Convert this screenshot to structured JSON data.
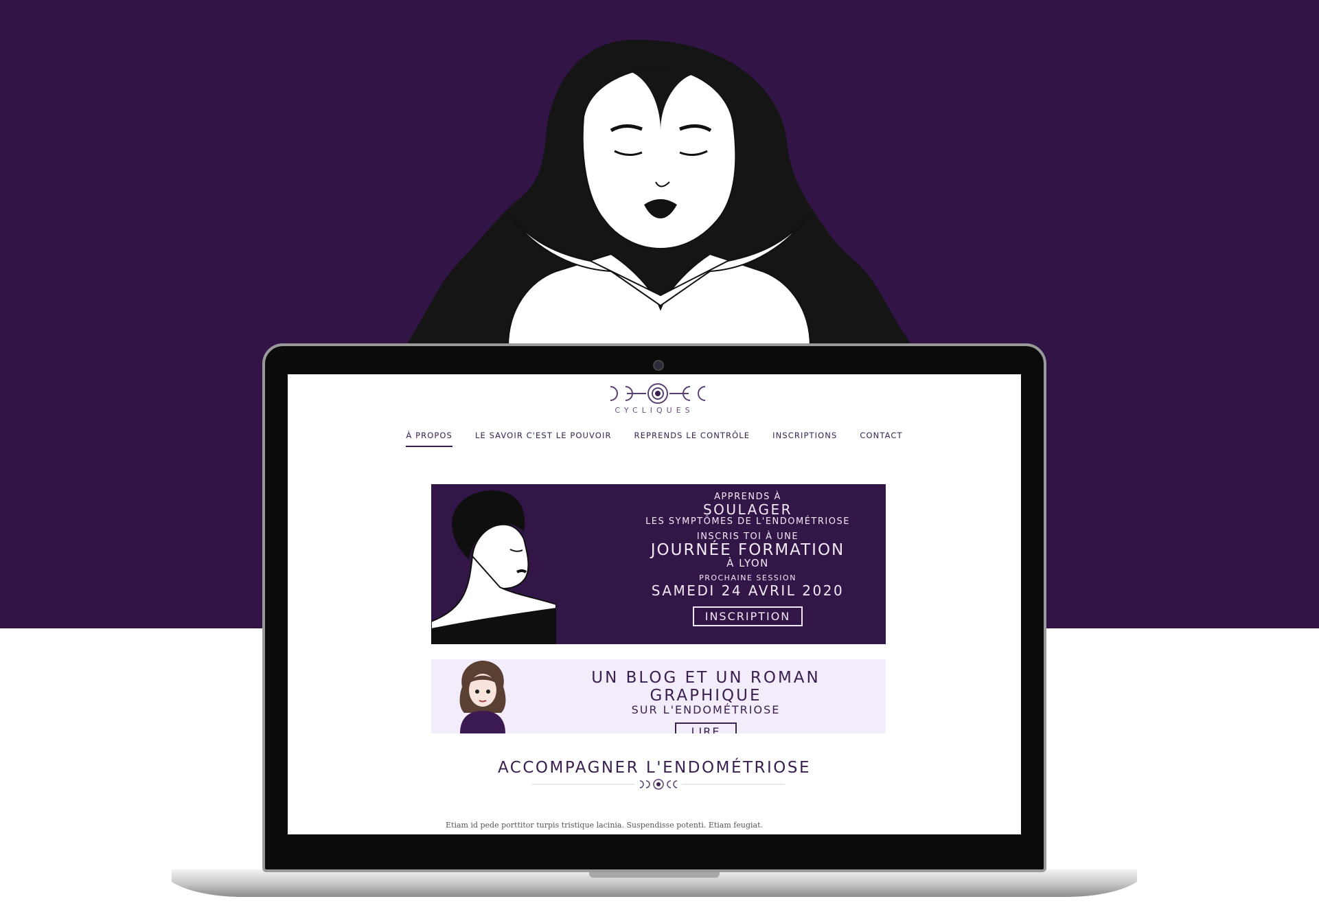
{
  "website": {
    "logo_text": "CYCLIQUES",
    "nav": [
      {
        "label": "À PROPOS",
        "active": true
      },
      {
        "label": "LE SAVOIR C'EST LE POUVOIR",
        "active": false
      },
      {
        "label": "REPRENDS LE CONTRÔLE",
        "active": false
      },
      {
        "label": "INSCRIPTIONS",
        "active": false
      },
      {
        "label": "CONTACT",
        "active": false
      }
    ],
    "banner": {
      "line1": "APPRENDS À",
      "line2": "SOULAGER",
      "line3": "LES SYMPTÔMES DE L'ENDOMÉTRIOSE",
      "line4": "INSCRIS TOI À UNE",
      "line5": "JOURNÉE FORMATION",
      "line6": "À LYON",
      "line7": "PROCHAINE SESSION",
      "line8": "SAMEDI 24 AVRIL 2020",
      "button": "INSCRIPTION"
    },
    "blog": {
      "title": "UN BLOG ET UN ROMAN GRAPHIQUE",
      "subtitle": "SUR L'ENDOMÉTRIOSE",
      "button": "LIRE"
    },
    "section_title": "ACCOMPAGNER L'ENDOMÉTRIOSE",
    "paragraph": "Etiam id pede porttitor turpis tristique lacinia. Suspendisse potenti. Etiam feugiat."
  },
  "colors": {
    "brand_purple": "#321447",
    "banner_bg": "#331648",
    "blog_bg": "#f3ecfa",
    "text_purple": "#3a2050"
  }
}
